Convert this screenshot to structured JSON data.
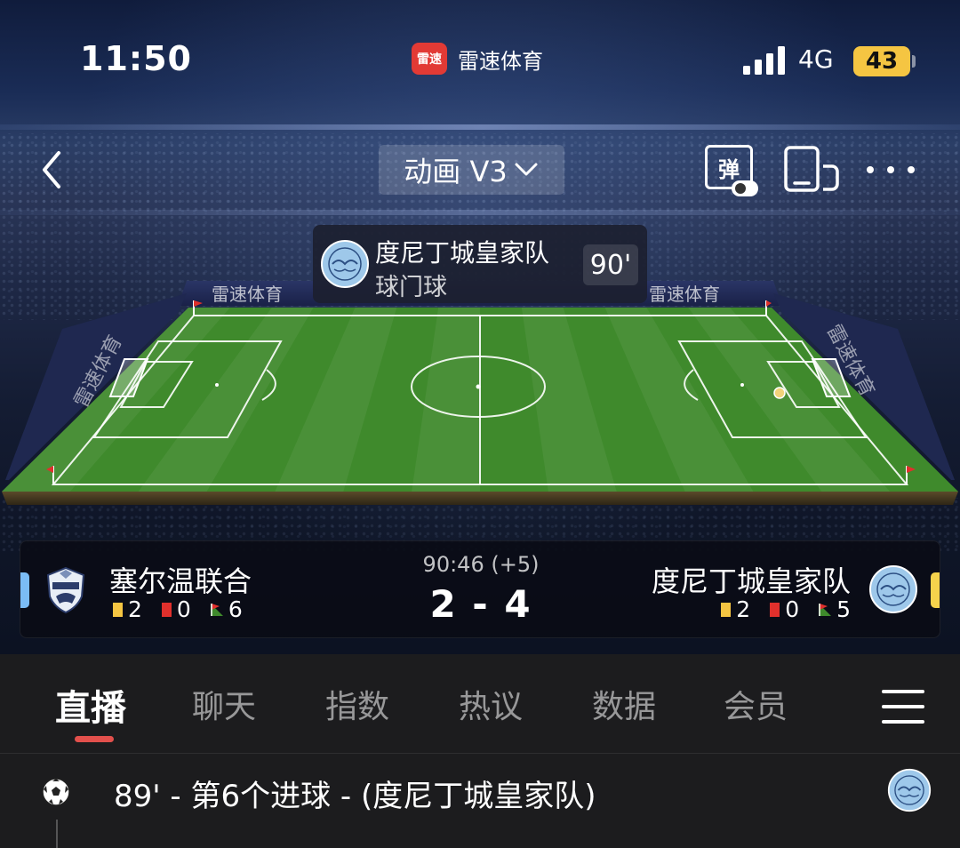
{
  "status_bar": {
    "time": "11:50",
    "app_logo_text": "雷速",
    "app_name": "雷速体育",
    "network": "4G",
    "battery": "43"
  },
  "top_nav": {
    "mode_label": "动画 V3",
    "danmaku_label": "弹"
  },
  "event_popup": {
    "team": "度尼丁城皇家队",
    "event": "球门球",
    "minute": "90'"
  },
  "pitch": {
    "ad_boards": [
      "雷速体育",
      "雷速体育",
      "雷速体育",
      "雷速体育"
    ]
  },
  "scoreboard": {
    "clock": "90:46 (+5)",
    "score": "2 - 4",
    "home": {
      "name": "塞尔温联合",
      "yellow_cards": "2",
      "red_cards": "0",
      "corners": "6",
      "marker_color": "#7bbcf5"
    },
    "away": {
      "name": "度尼丁城皇家队",
      "yellow_cards": "2",
      "red_cards": "0",
      "corners": "5",
      "marker_color": "#f5d24c"
    }
  },
  "tabs": [
    {
      "label": "直播",
      "active": true
    },
    {
      "label": "聊天",
      "active": false
    },
    {
      "label": "指数",
      "active": false
    },
    {
      "label": "热议",
      "active": false
    },
    {
      "label": "数据",
      "active": false
    },
    {
      "label": "会员",
      "active": false
    }
  ],
  "events": [
    {
      "icon": "soccer-ball-icon",
      "text": "89' - 第6个进球 - (度尼丁城皇家队)"
    }
  ],
  "colors": {
    "accent_red": "#e2504c",
    "yellow_card": "#f5c542",
    "red_card": "#e0302c",
    "pitch_green": "#3f8a2c"
  }
}
